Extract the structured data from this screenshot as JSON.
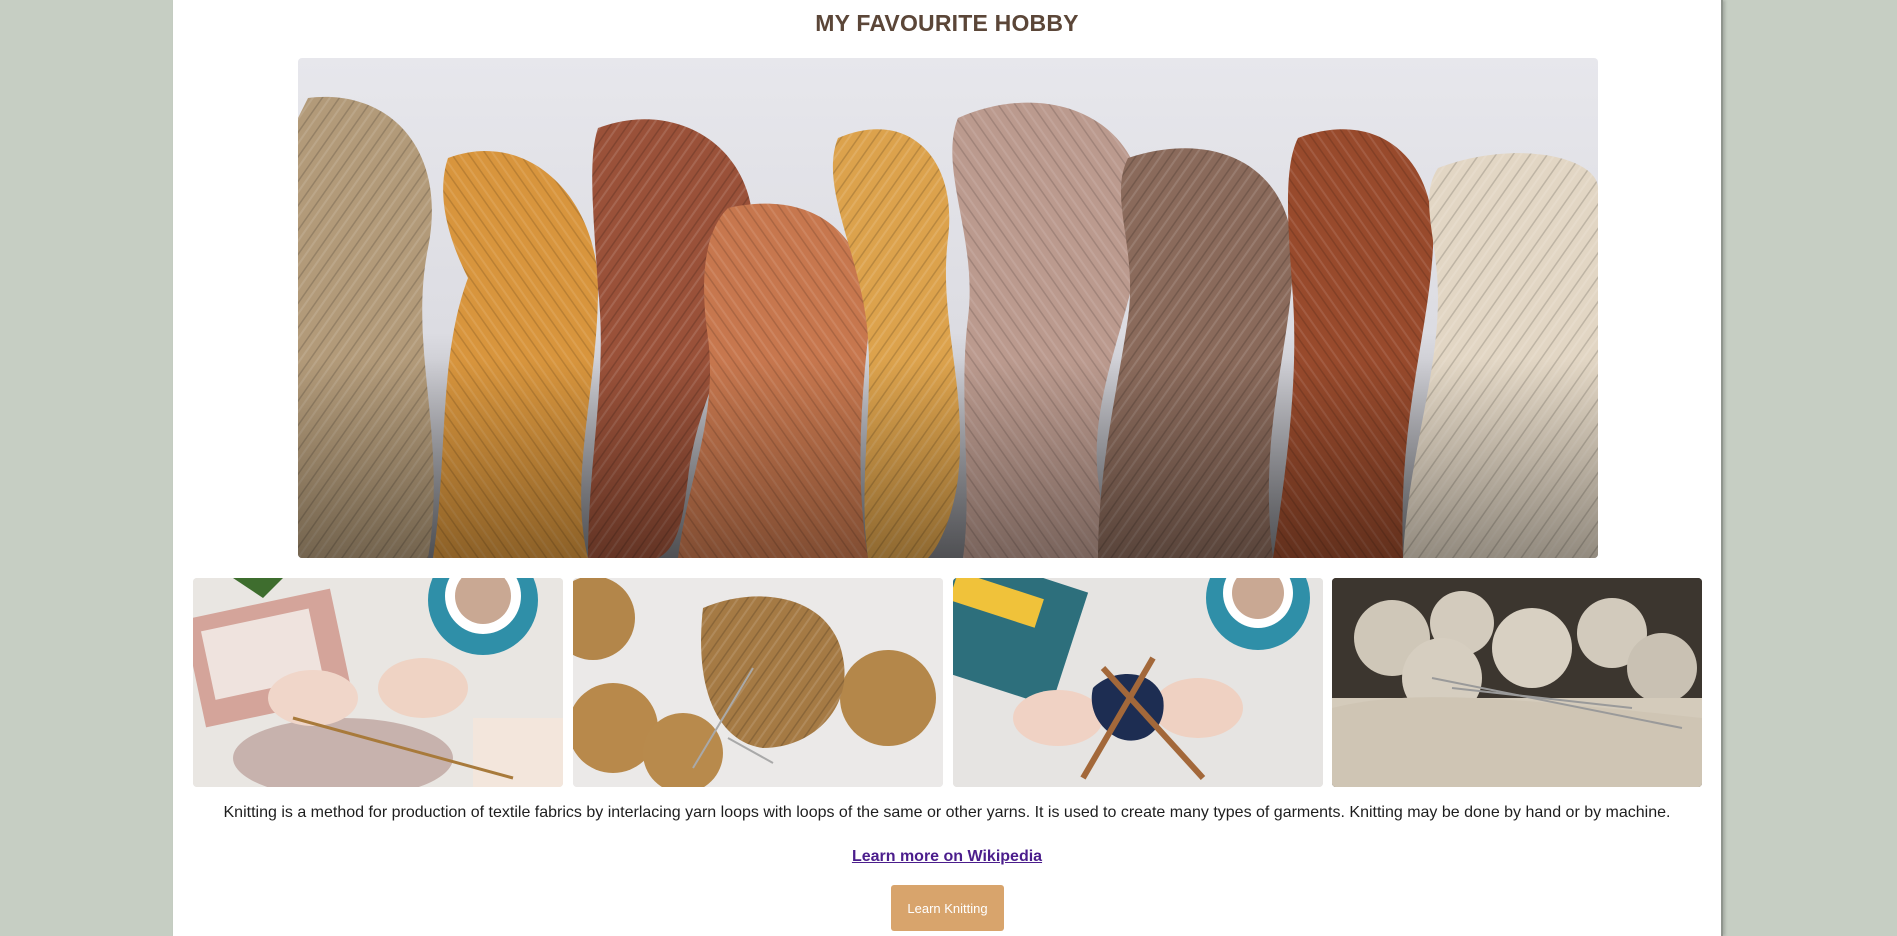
{
  "page": {
    "title": "MY FAVOURITE HOBBY",
    "description": "Knitting is a method for production of textile fabrics by interlacing yarn loops with loops of the same or other yarns. It is used to create many types of garments. Knitting may be done by hand or by machine.",
    "link_text": "Learn more on Wikipedia",
    "button_label": "Learn Knitting"
  },
  "images": {
    "hero": "yarn-skeins-photo",
    "gallery": [
      "hands-knitting-with-coffee-photo",
      "mustard-yarn-balls-and-knit-photo",
      "hands-casting-on-blue-yarn-photo",
      "cream-yarn-balls-with-needles-photo"
    ]
  },
  "colors": {
    "background": "#c6cec3",
    "title": "#5b4638",
    "link": "#4b1d8c",
    "button": "#d8a46c"
  }
}
